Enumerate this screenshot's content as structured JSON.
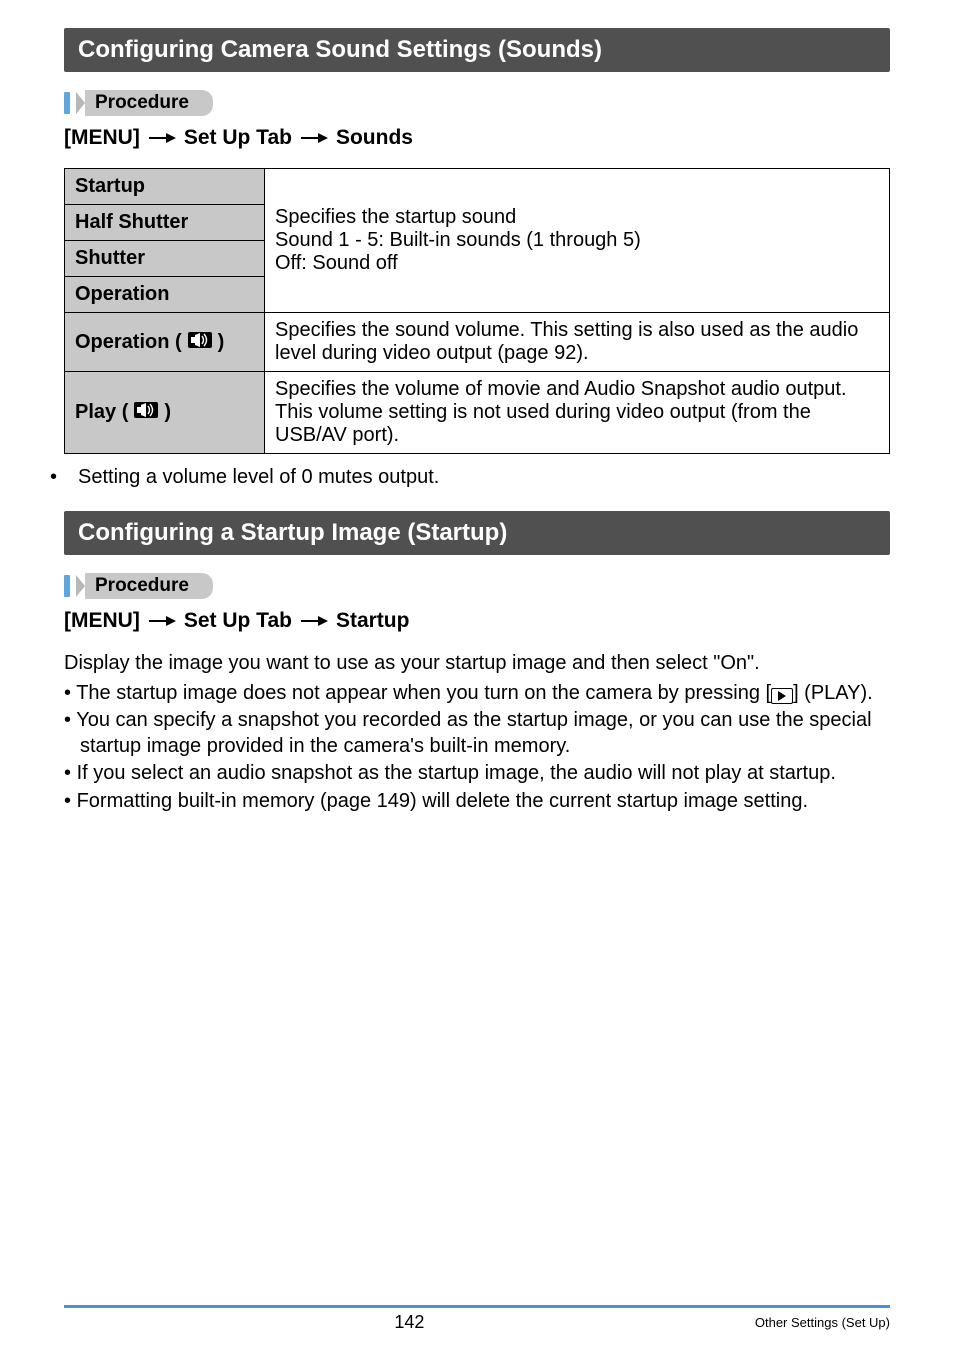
{
  "section1_title": "Configuring Camera Sound Settings (Sounds)",
  "procedure_label": "Procedure",
  "menu_path1_parts": [
    "[MENU]",
    "Set Up Tab",
    "Sounds"
  ],
  "table": {
    "startup_label": "Startup",
    "half_shutter_label": "Half Shutter",
    "shutter_label": "Shutter",
    "operation_label": "Operation",
    "sound_desc_line1": "Specifies the startup sound",
    "sound_desc_line2": "Sound 1 - 5: Built-in sounds (1 through 5)",
    "sound_desc_line3": "Off: Sound off",
    "operation_vol_label_pre": "Operation (",
    "operation_vol_label_post": ")",
    "operation_vol_desc": "Specifies the sound volume. This setting is also used as the audio level during video output (page 92).",
    "play_label_pre": "Play (",
    "play_label_post": ")",
    "play_desc": "Specifies the volume of movie and Audio Snapshot audio output. This volume setting is not used during video output (from the USB/AV port)."
  },
  "note_after_table": "Setting a volume level of 0 mutes output.",
  "section2_title": "Configuring a Startup Image (Startup)",
  "menu_path2_parts": [
    "[MENU]",
    "Set Up Tab",
    "Startup"
  ],
  "startup_intro": "Display the image you want to use as your startup image and then select \"On\".",
  "startup_bullets": {
    "b1_pre": "The startup image does not appear when you turn on the camera by pressing [",
    "b1_post": "] (PLAY).",
    "b2": "You can specify a snapshot you recorded as the startup image, or you can use the special startup image provided in the camera's built-in memory.",
    "b3": "If you select an audio snapshot as the startup image, the audio will not play at startup.",
    "b4": "Formatting built-in memory (page 149) will delete the current startup image setting."
  },
  "footer": {
    "page_number": "142",
    "section_name": "Other Settings (Set Up)"
  }
}
